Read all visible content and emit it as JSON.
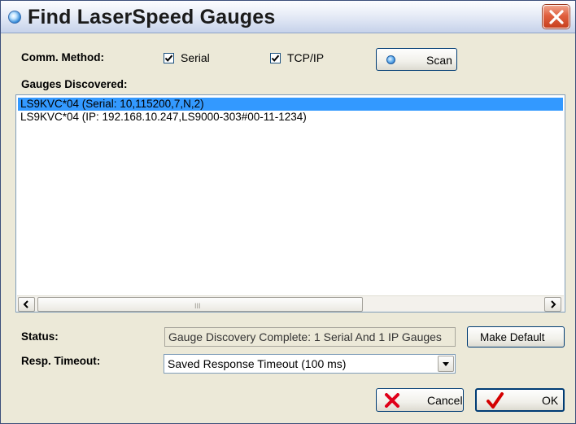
{
  "window": {
    "title": "Find LaserSpeed Gauges",
    "close_icon": "close-x-icon"
  },
  "comm": {
    "label": "Comm. Method:",
    "serial": {
      "label": "Serial",
      "checked": true
    },
    "tcpip": {
      "label": "TCP/IP",
      "checked": true
    },
    "scan_label": "Scan"
  },
  "gauges": {
    "label": "Gauges Discovered:",
    "items": [
      {
        "text": "LS9KVC*04 (Serial: 10,115200,7,N,2)",
        "selected": true
      },
      {
        "text": "LS9KVC*04 (IP: 192.168.10.247,LS9000-303#00-11-1234)",
        "selected": false
      }
    ],
    "scroll_grip": "III"
  },
  "status": {
    "label": "Status:",
    "value": "Gauge Discovery Complete: 1 Serial And 1 IP Gauges",
    "make_default_label": "Make Default"
  },
  "timeout": {
    "label": "Resp. Timeout:",
    "selected": "Saved Response Timeout (100 ms)"
  },
  "footer": {
    "cancel_label": "Cancel",
    "ok_label": "OK"
  },
  "colors": {
    "selection": "#3399ff",
    "dialog_bg": "#ece9d8",
    "cancel_x": "#e0001a",
    "ok_check": "#d40000"
  }
}
